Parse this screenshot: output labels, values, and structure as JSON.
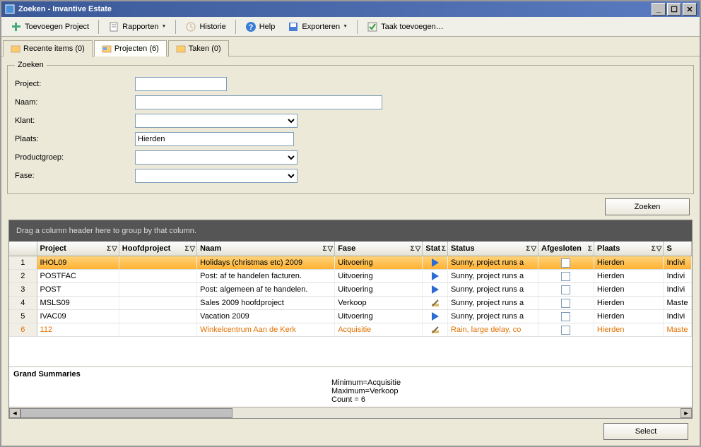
{
  "window": {
    "title": "Zoeken - Invantive Estate"
  },
  "toolbar": {
    "toevoegen": "Toevoegen Project",
    "rapporten": "Rapporten",
    "historie": "Historie",
    "help": "Help",
    "exporteren": "Exporteren",
    "taak": "Taak toevoegen…"
  },
  "tabs": {
    "recente": "Recente items (0)",
    "projecten": "Projecten (6)",
    "taken": "Taken (0)"
  },
  "search": {
    "legend": "Zoeken",
    "labels": {
      "project": "Project:",
      "naam": "Naam:",
      "klant": "Klant:",
      "plaats": "Plaats:",
      "productgroep": "Productgroep:",
      "fase": "Fase:"
    },
    "values": {
      "project": "",
      "naam": "",
      "klant": "",
      "plaats": "Hierden",
      "productgroep": "",
      "fase": ""
    },
    "button": "Zoeken"
  },
  "grid": {
    "groupbar": "Drag a column header here to group by that column.",
    "headers": {
      "num": "",
      "project": "Project",
      "hoofdproject": "Hoofdproject",
      "naam": "Naam",
      "fase": "Fase",
      "stat": "Stat",
      "status": "Status",
      "afgesloten": "Afgesloten",
      "plaats": "Plaats",
      "s": "S"
    },
    "rows": [
      {
        "n": "1",
        "project": "IHOL09",
        "hp": "",
        "naam": "Holidays (christmas etc) 2009",
        "fase": "Uitvoering",
        "stat": "play",
        "status": "Sunny, project runs a",
        "afg": false,
        "plaats": "Hierden",
        "s": "Indivi",
        "sel": true
      },
      {
        "n": "2",
        "project": "POSTFAC",
        "hp": "",
        "naam": "Post: af te handelen facturen.",
        "fase": "Uitvoering",
        "stat": "play",
        "status": "Sunny, project runs a",
        "afg": false,
        "plaats": "Hierden",
        "s": "Indivi"
      },
      {
        "n": "3",
        "project": "POST",
        "hp": "",
        "naam": "Post: algemeen af te handelen.",
        "fase": "Uitvoering",
        "stat": "play",
        "status": "Sunny, project runs a",
        "afg": false,
        "plaats": "Hierden",
        "s": "Indivi"
      },
      {
        "n": "4",
        "project": "MSLS09",
        "hp": "",
        "naam": "Sales 2009 hoofdproject",
        "fase": "Verkoop",
        "stat": "edit",
        "status": "Sunny, project runs a",
        "afg": false,
        "plaats": "Hierden",
        "s": "Maste"
      },
      {
        "n": "5",
        "project": "IVAC09",
        "hp": "",
        "naam": "Vacation 2009",
        "fase": "Uitvoering",
        "stat": "play",
        "status": "Sunny, project runs a",
        "afg": false,
        "plaats": "Hierden",
        "s": "Indivi"
      },
      {
        "n": "6",
        "project": "112",
        "hp": "",
        "naam": "Winkelcentrum Aan de Kerk",
        "fase": "Acquisitie",
        "stat": "edit",
        "status": "Rain, large delay, co",
        "afg": false,
        "plaats": "Hierden",
        "s": "Maste",
        "orange": true
      }
    ],
    "summaries": {
      "title": "Grand Summaries",
      "min": "Minimum=Acquisitie",
      "max": "Maximum=Verkoop",
      "count": "Count = 6"
    }
  },
  "footer": {
    "select": "Select"
  }
}
